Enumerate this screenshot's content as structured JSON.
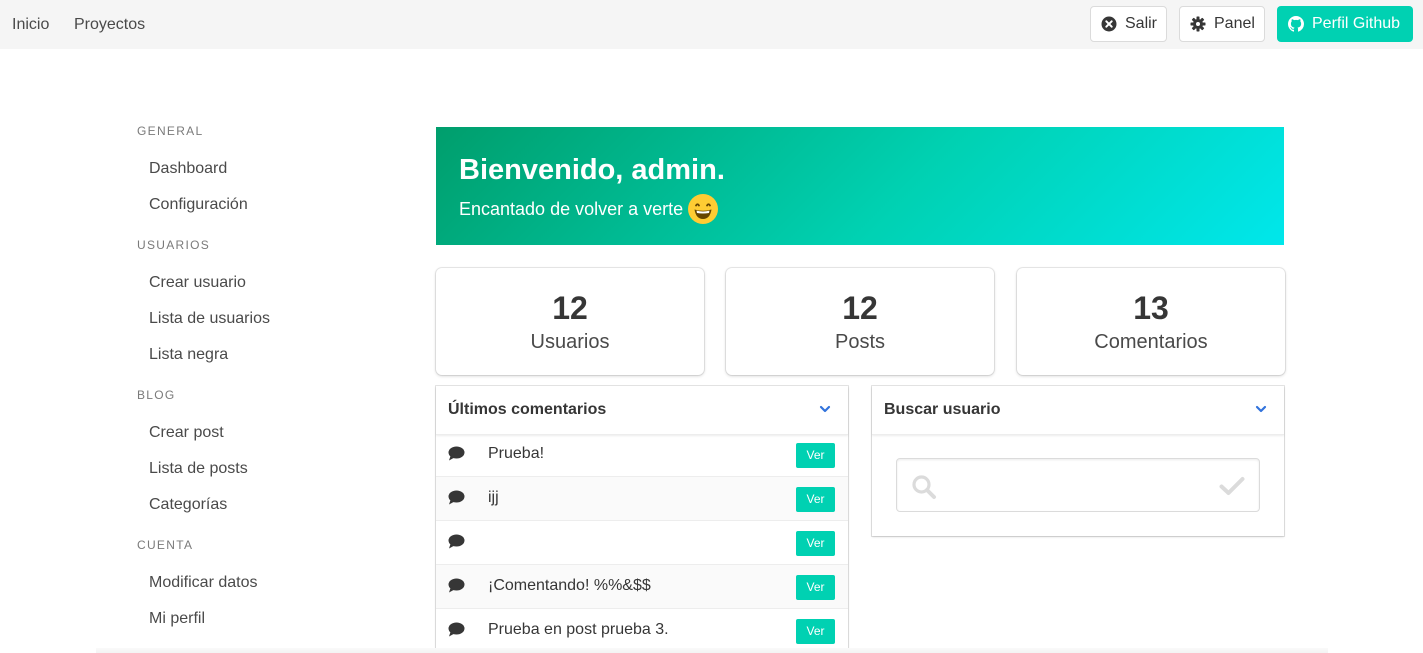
{
  "nav": {
    "links": [
      "Inicio",
      "Proyectos"
    ],
    "logout_label": "Salir",
    "panel_label": "Panel",
    "github_label": "Perfil Github"
  },
  "sidebar": {
    "sections": [
      {
        "label": "General",
        "items": [
          "Dashboard",
          "Configuración"
        ]
      },
      {
        "label": "Usuarios",
        "items": [
          "Crear usuario",
          "Lista de usuarios",
          "Lista negra"
        ]
      },
      {
        "label": "Blog",
        "items": [
          "Crear post",
          "Lista de posts",
          "Categorías"
        ]
      },
      {
        "label": "Cuenta",
        "items": [
          "Modificar datos",
          "Mi perfil"
        ]
      }
    ]
  },
  "hero": {
    "title": "Bienvenido, admin.",
    "subtitle": "Encantado de volver a verte"
  },
  "stats": [
    {
      "value": "12",
      "label": "Usuarios"
    },
    {
      "value": "12",
      "label": "Posts"
    },
    {
      "value": "13",
      "label": "Comentarios"
    }
  ],
  "comments_card": {
    "title": "Últimos comentarios",
    "view_label": "Ver",
    "comments": [
      "Prueba!",
      "ijj",
      "",
      "¡Comentando! %%&$$",
      "Prueba en post prueba 3."
    ]
  },
  "search_card": {
    "title": "Buscar usuario",
    "value": "",
    "placeholder": ""
  },
  "colors": {
    "accent": "#00d1b2",
    "hero_start": "#009e6c",
    "hero_end": "#00e7eb",
    "toggle": "#3273dc",
    "navbar_bg": "#f5f5f5"
  },
  "icons": {
    "logout": "times-circle-icon",
    "panel": "gear-icon",
    "github": "github-icon",
    "emoji": "grinning-face-emoji",
    "comment": "comment-bubble-icon",
    "toggle": "chevron-down-icon",
    "search": "search-icon",
    "check": "check-icon"
  }
}
